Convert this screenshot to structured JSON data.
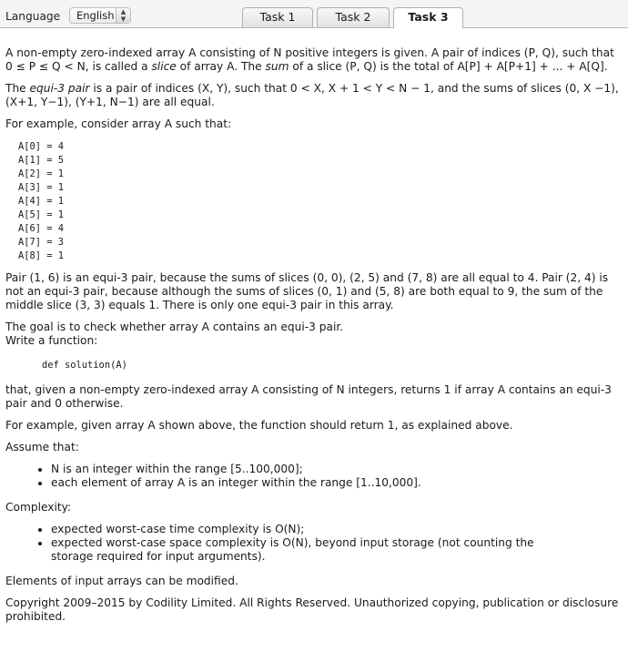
{
  "toolbar": {
    "language_label": "Language",
    "language_value": "English",
    "tabs": [
      "Task 1",
      "Task 2",
      "Task 3"
    ],
    "active_tab": "Task 3"
  },
  "task": {
    "intro_1": "A non-empty zero-indexed array A consisting of N positive integers is given. A pair of indices (P, Q), such that 0 ≤ P ≤ Q < N, is called a ",
    "intro_slice": "slice",
    "intro_2": " of array A. The ",
    "intro_sum": "sum",
    "intro_3": " of a slice (P, Q) is the total of A[P] + A[P+1] + ... + A[Q].",
    "def_term": "equi-3 pair",
    "def_1": "The ",
    "def_2": " is a pair of indices (X, Y), such that 0 < X, X + 1 < Y < N − 1, and the sums of slices (0, X −1), (X+1, Y−1), (Y+1, N−1) are all equal.",
    "example_intro": "For example, consider array A such that:",
    "array": [
      "A[0] = 4",
      "A[1] = 5",
      "A[2] = 1",
      "A[3] = 1",
      "A[4] = 1",
      "A[5] = 1",
      "A[6] = 4",
      "A[7] = 3",
      "A[8] = 1"
    ],
    "explanation": "Pair (1, 6) is an equi-3 pair, because the sums of slices (0, 0), (2, 5) and (7, 8) are all equal to 4. Pair (2, 4) is not an equi-3 pair, because although the sums of slices (0, 1) and (5, 8) are both equal to 9, the sum of the middle slice (3, 3) equals 1. There is only one equi-3 pair in this array.",
    "goal": "The goal is to check whether array A contains an equi-3 pair.",
    "write": "Write a function:",
    "signature": "def solution(A)",
    "returns": "that, given a non-empty zero-indexed array A consisting of N integers, returns 1 if array A contains an equi-3 pair and 0 otherwise.",
    "example_result": "For example, given array A shown above, the function should return 1, as explained above.",
    "assume": "Assume that:",
    "assumptions": [
      "N is an integer within the range [5..100,000];",
      "each element of array A is an integer within the range [1..10,000]."
    ],
    "complexity_label": "Complexity:",
    "complexity": [
      "expected worst-case time complexity is O(N);",
      "expected worst-case space complexity is O(N), beyond input storage (not counting the storage required for input arguments)."
    ],
    "modifiable": "Elements of input arrays can be modified.",
    "copyright": "Copyright 2009–2015 by Codility Limited. All Rights Reserved. Unauthorized copying, publication or disclosure prohibited."
  }
}
